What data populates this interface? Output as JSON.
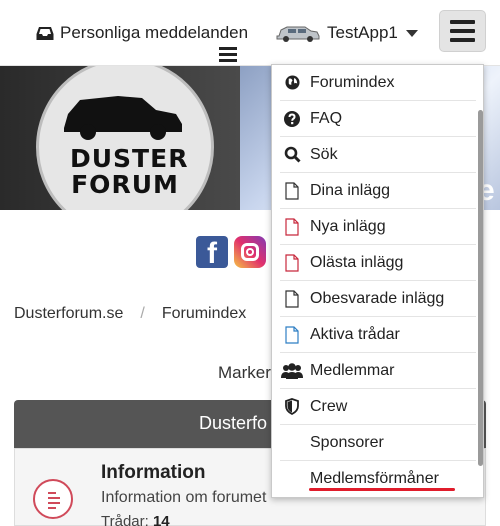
{
  "topbar": {
    "private_messages": "Personliga meddelanden",
    "username": "TestApp1"
  },
  "social": {
    "facebook_letter": "f"
  },
  "banner": {
    "logo_line1": "DUSTER",
    "logo_line2": "FORUM",
    "edge_text": "e"
  },
  "breadcrumb": {
    "items": [
      "Dusterforum.se",
      "Forumindex"
    ],
    "separator": "/"
  },
  "mark_text": "Marker",
  "forum": {
    "header": "Dusterfo",
    "title": "Information",
    "description": "Information om forumet",
    "threads_label": "Trådar:",
    "threads_count": "14"
  },
  "menu": {
    "items": [
      {
        "label": "Forumindex",
        "icon": "globe-icon"
      },
      {
        "label": "FAQ",
        "icon": "question-circle-icon"
      },
      {
        "label": "Sök",
        "icon": "search-icon"
      },
      {
        "label": "Dina inlägg",
        "icon": "file-icon"
      },
      {
        "label": "Nya inlägg",
        "icon": "file-red-icon"
      },
      {
        "label": "Olästa inlägg",
        "icon": "file-red-icon"
      },
      {
        "label": "Obesvarade inlägg",
        "icon": "file-icon"
      },
      {
        "label": "Aktiva trådar",
        "icon": "file-blue-icon"
      },
      {
        "label": "Medlemmar",
        "icon": "users-icon"
      },
      {
        "label": "Crew",
        "icon": "shield-icon"
      },
      {
        "label": "Sponsorer",
        "icon": ""
      },
      {
        "label": "Medlemsförmåner",
        "icon": ""
      }
    ]
  },
  "colors": {
    "accent_red": "#e01c2b",
    "file_red": "#c8283c",
    "file_blue": "#2f7fc4",
    "facebook": "#3b5998"
  }
}
